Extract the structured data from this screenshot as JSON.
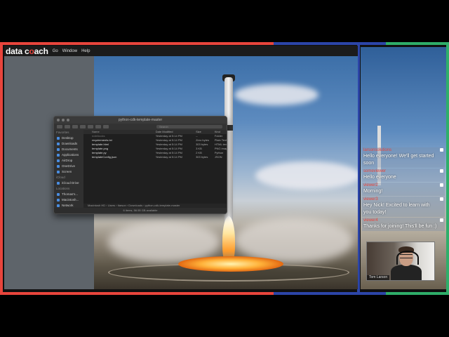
{
  "brand": {
    "logo_left": "data c",
    "logo_accent": "o",
    "logo_right": "ach"
  },
  "menubar": {
    "items": [
      "Go",
      "Window",
      "Help"
    ]
  },
  "finder": {
    "title": "python-cdk-template-master",
    "search_placeholder": "Search",
    "sidebar": {
      "favorites_header": "Favorites",
      "favorites": [
        "Desktop",
        "Downloads",
        "Documents",
        "Applications",
        "AirDrop",
        "OneDrive",
        "Screen"
      ],
      "icloud_header": "iCloud",
      "icloud": [
        "iCloud Drive"
      ],
      "locations_header": "Locations",
      "locations": [
        "Thomas's...",
        "Macintosh...",
        "Network"
      ]
    },
    "columns": {
      "name": "Name",
      "date": "Date Modified",
      "size": "Size",
      "kind": "Kind"
    },
    "files": [
      {
        "name": "notebooks",
        "date": "Yesterday at 5:14 PM",
        "size": "--",
        "kind": "Folder"
      },
      {
        "name": "requirements.txt",
        "date": "Yesterday at 5:14 PM",
        "size": "Zero bytes",
        "kind": "Plain Text"
      },
      {
        "name": "template.html",
        "date": "Yesterday at 5:14 PM",
        "size": "303 bytes",
        "kind": "HTML text"
      },
      {
        "name": "template.png",
        "date": "Yesterday at 5:14 PM",
        "size": "3 KB",
        "kind": "PNG image"
      },
      {
        "name": "template.py",
        "date": "Yesterday at 5:14 PM",
        "size": "2 KB",
        "kind": "Python"
      },
      {
        "name": "templateConfig.json",
        "date": "Yesterday at 5:14 PM",
        "size": "303 bytes",
        "kind": "JSON"
      }
    ],
    "path": [
      "Macintosh HD",
      "Users",
      "tlarson",
      "Downloads",
      "python-cdk-template-master"
    ],
    "status": "6 items, 56.55 GB available"
  },
  "chat": {
    "messages": [
      {
        "user": "larsonsolutions",
        "text": "Hello everyone! We'll get started soon"
      },
      {
        "user": "someviewer",
        "text": "Hello everyone"
      },
      {
        "user": "viewer2",
        "text": "Morning!"
      },
      {
        "user": "viewer3",
        "text": "Hey Nick! Excited to learn with you today!"
      },
      {
        "user": "viewer4",
        "text": "Thanks for joining! This'll be fun :)"
      }
    ]
  },
  "webcam": {
    "name": "Tom Larson"
  },
  "colors": {
    "red": "#e8453c",
    "blue": "#2c45a8",
    "green": "#2fae6a",
    "accent": "#e8453c"
  }
}
